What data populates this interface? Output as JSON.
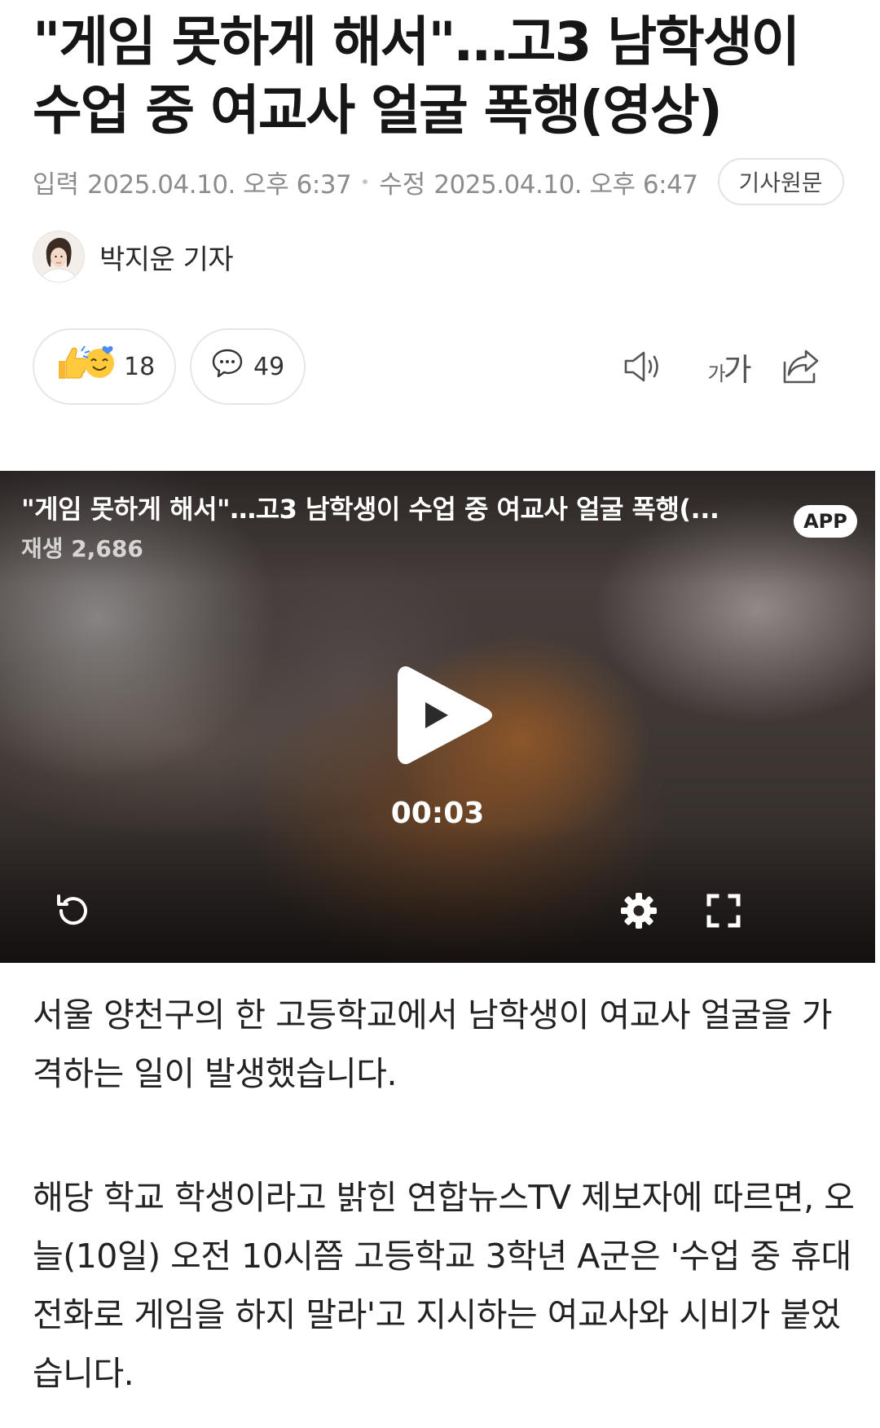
{
  "article": {
    "headline": "\"게임 못하게 해서\"…고3 남학생이 수업 중 여교사 얼굴 폭행(영상)",
    "meta": {
      "input_label": "입력",
      "input_time": "2025.04.10. 오후 6:37",
      "modified_label": "수정",
      "modified_time": "2025.04.10. 오후 6:47",
      "original_button": "기사원문"
    },
    "reporter": {
      "name": "박지운 기자"
    },
    "actions": {
      "reaction_count": "18",
      "comment_count": "49",
      "icons": [
        "reaction-emoji-icon",
        "comment-icon",
        "speaker-icon",
        "font-size-icon",
        "share-icon"
      ],
      "font_size_small": "가",
      "font_size_large": "가"
    },
    "video": {
      "title": "\"게임 못하게 해서\"…고3 남학생이 수업 중 여교사 얼굴 폭행(...",
      "views": "재생 2,686",
      "app_badge": "APP",
      "time": "00:03",
      "controls": [
        "replay-icon",
        "settings-icon",
        "fullscreen-icon"
      ]
    },
    "paragraphs": [
      "서울 양천구의 한 고등학교에서 남학생이 여교사 얼굴을 가격하는 일이 발생했습니다.",
      "해당 학교 학생이라고 밝힌 연합뉴스TV 제보자에 따르면, 오늘(10일) 오전 10시쯤 고등학교 3학년 A군은 '수업 중 휴대전화로 게임을 하지 말라'고 지시하는 여교사와 시비가 붙었습니다."
    ]
  }
}
